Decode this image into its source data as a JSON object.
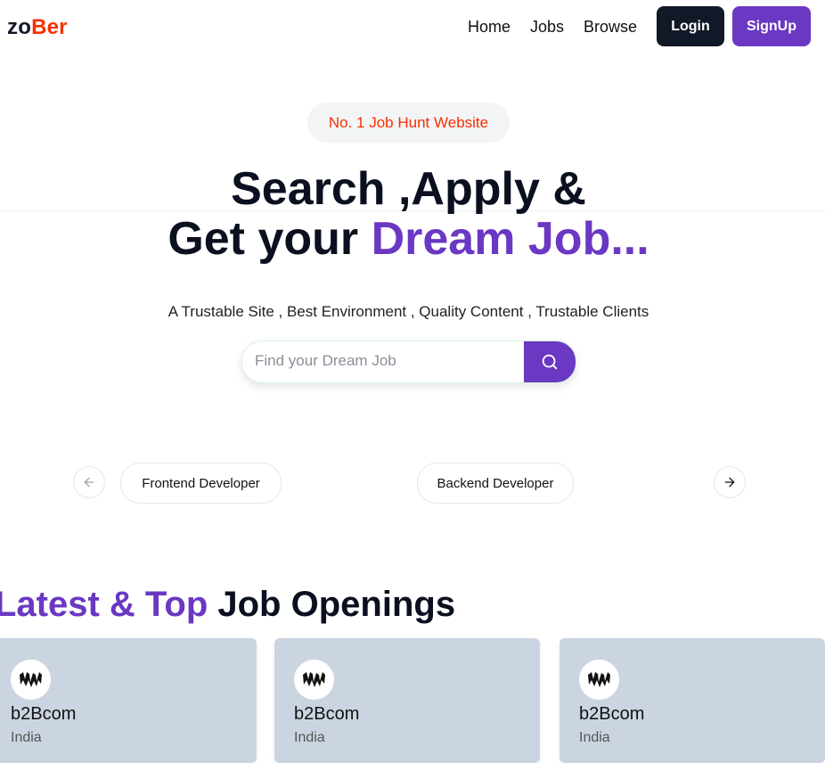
{
  "brand": {
    "part1": "zo",
    "part2": "Ber",
    "accent_color": "#f83002"
  },
  "nav": {
    "links": [
      "Home",
      "Jobs",
      "Browse"
    ],
    "login": "Login",
    "signup": "SignUp"
  },
  "hero": {
    "badge": "No. 1 Job Hunt Website",
    "line1": "Search ,Apply &",
    "line2_prefix": "Get your ",
    "line2_accent": "Dream Job...",
    "subtitle": "A Trustable Site , Best Environment , Quality Content , Trustable Clients",
    "accent_color": "#6a38c2"
  },
  "search": {
    "placeholder": "Find your Dream Job",
    "icon": "search-icon"
  },
  "categories": {
    "items": [
      "Frontend Developer",
      "Backend Developer"
    ],
    "prev_icon": "arrow-left-icon",
    "next_icon": "arrow-right-icon"
  },
  "latest": {
    "title_accent": "Latest & Top",
    "title_rest": " Job Openings",
    "jobs": [
      {
        "logo_text": "MICROSOFT",
        "company": "b2Bcom",
        "location": "India"
      },
      {
        "logo_text": "MICROSOFT",
        "company": "b2Bcom",
        "location": "India"
      },
      {
        "logo_text": "MICROSOFT",
        "company": "b2Bcom",
        "location": "India"
      }
    ]
  }
}
